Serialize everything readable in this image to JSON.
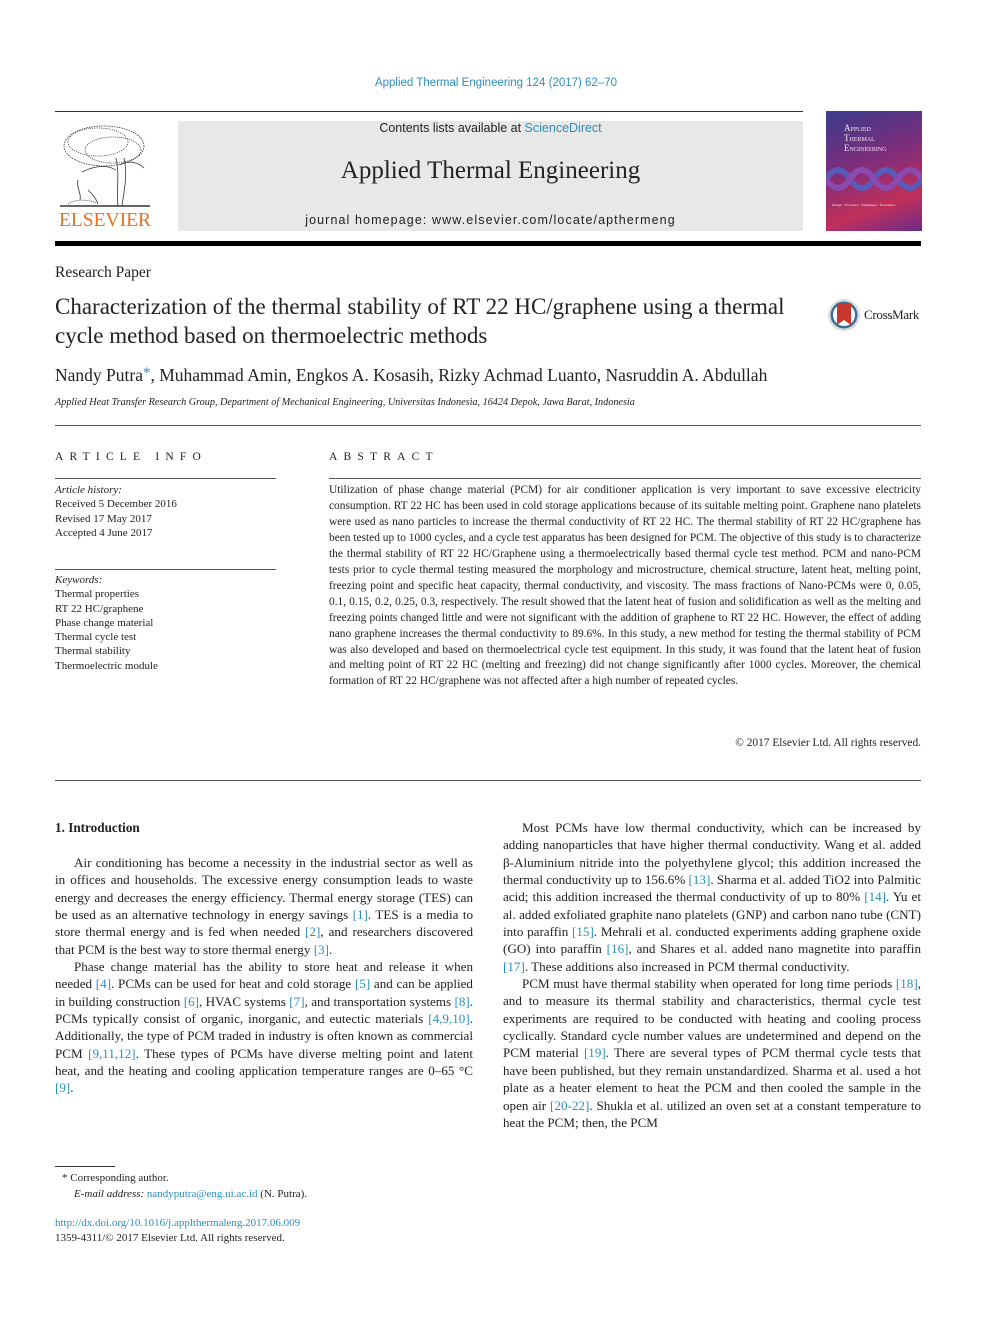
{
  "header": {
    "journal_ref": "Applied Thermal Engineering 124 (2017) 62–70",
    "contents_prefix": "Contents lists available at ",
    "contents_link": "ScienceDirect",
    "journal_title": "Applied Thermal Engineering",
    "homepage_prefix": "journal homepage: ",
    "homepage_url": "www.elsevier.com/locate/apthermeng",
    "publisher_logo": "ELSEVIER",
    "cover_title": [
      "Applied",
      "Thermal",
      "Engineering"
    ],
    "cover_subtitle": "Design · Processes · Equipment · Economics"
  },
  "article": {
    "type": "Research Paper",
    "title": "Characterization of the thermal stability of RT 22 HC/graphene using a thermal cycle method based on thermoelectric methods",
    "crossmark_label": "CrossMark",
    "authors": "Nandy Putra",
    "author_marker": "*",
    "authors_rest": ", Muhammad Amin, Engkos A. Kosasih, Rizky Achmad Luanto, Nasruddin A. Abdullah",
    "affiliation": "Applied Heat Transfer Research Group, Department of Mechanical Engineering, Universitas Indonesia, 16424 Depok, Jawa Barat, Indonesia"
  },
  "article_info": {
    "label": "ARTICLE INFO",
    "history_label": "Article history:",
    "history": [
      "Received 5 December 2016",
      "Revised 17 May 2017",
      "Accepted 4 June 2017"
    ],
    "keywords_label": "Keywords:",
    "keywords": [
      "Thermal properties",
      "RT 22 HC/graphene",
      "Phase change material",
      "Thermal cycle test",
      "Thermal stability",
      "Thermoelectric module"
    ]
  },
  "abstract": {
    "label": "ABSTRACT",
    "text": "Utilization of phase change material (PCM) for air conditioner application is very important to save excessive electricity consumption. RT 22 HC has been used in cold storage applications because of its suitable melting point. Graphene nano platelets were used as nano particles to increase the thermal conductivity of RT 22 HC. The thermal stability of RT 22 HC/graphene has been tested up to 1000 cycles, and a cycle test apparatus has been designed for PCM. The objective of this study is to characterize the thermal stability of RT 22 HC/Graphene using a thermoelectrically based thermal cycle test method. PCM and nano-PCM tests prior to cycle thermal testing measured the morphology and microstructure, chemical structure, latent heat, melting point, freezing point and specific heat capacity, thermal conductivity, and viscosity. The mass fractions of Nano-PCMs were 0, 0.05, 0.1, 0.15, 0.2, 0.25, 0.3, respectively. The result showed that the latent heat of fusion and solidification as well as the melting and freezing points changed little and were not significant with the addition of graphene to RT 22 HC. However, the effect of adding nano graphene increases the thermal conductivity to 89.6%. In this study, a new method for testing the thermal stability of PCM was also developed and based on thermoelectrical cycle test equipment. In this study, it was found that the latent heat of fusion and melting point of RT 22 HC (melting and freezing) did not change significantly after 1000 cycles. Moreover, the chemical formation of RT 22 HC/graphene was not affected after a high number of repeated cycles.",
    "copyright": "© 2017 Elsevier Ltd. All rights reserved."
  },
  "body": {
    "section_heading": "1. Introduction",
    "left_paragraphs": [
      [
        {
          "t": "Air conditioning has become a necessity in the industrial sector as well as in offices and households. The excessive energy consumption leads to waste energy and decreases the energy efficiency. Thermal energy storage (TES) can be used as an alternative technology in energy savings "
        },
        {
          "ref": "[1]"
        },
        {
          "t": ". TES is a media to store thermal energy and is fed when needed "
        },
        {
          "ref": "[2]"
        },
        {
          "t": ", and researchers discovered that PCM is the best way to store thermal energy "
        },
        {
          "ref": "[3]"
        },
        {
          "t": "."
        }
      ],
      [
        {
          "t": "Phase change material has the ability to store heat and release it when needed "
        },
        {
          "ref": "[4]"
        },
        {
          "t": ". PCMs can be used for heat and cold storage "
        },
        {
          "ref": "[5]"
        },
        {
          "t": " and can be applied in building construction "
        },
        {
          "ref": "[6]"
        },
        {
          "t": ", HVAC systems "
        },
        {
          "ref": "[7]"
        },
        {
          "t": ", and transportation systems "
        },
        {
          "ref": "[8]"
        },
        {
          "t": ". PCMs typically consist of organic, inorganic, and eutectic materials "
        },
        {
          "ref": "[4,9,10]"
        },
        {
          "t": ". Additionally, the type of PCM traded in industry is often known as commercial PCM "
        },
        {
          "ref": "[9,11,12]"
        },
        {
          "t": ". These types of PCMs have diverse melting point and latent heat, and the heating and cooling application temperature ranges are 0–65 °C "
        },
        {
          "ref": "[9]"
        },
        {
          "t": "."
        }
      ]
    ],
    "right_paragraphs": [
      [
        {
          "t": "Most PCMs have low thermal conductivity, which can be increased by adding nanoparticles that have higher thermal conductivity. Wang et al. added β-Aluminium nitride into the polyethylene glycol; this addition increased the thermal conductivity up to 156.6% "
        },
        {
          "ref": "[13]"
        },
        {
          "t": ". Sharma et al. added TiO2 into Palmitic acid; this addition increased the thermal conductivity of up to 80% "
        },
        {
          "ref": "[14]"
        },
        {
          "t": ". Yu et al. added exfoliated graphite nano platelets (GNP) and carbon nano tube (CNT) into paraffin "
        },
        {
          "ref": "[15]"
        },
        {
          "t": ". Mehrali et al. conducted experiments adding graphene oxide (GO) into paraffin "
        },
        {
          "ref": "[16]"
        },
        {
          "t": ", and Shares et al. added nano magnetite into paraffin "
        },
        {
          "ref": "[17]"
        },
        {
          "t": ". These additions also increased in PCM thermal conductivity."
        }
      ],
      [
        {
          "t": "PCM must have thermal stability when operated for long time periods "
        },
        {
          "ref": "[18]"
        },
        {
          "t": ", and to measure its thermal stability and characteristics, thermal cycle test experiments are required to be conducted with heating and cooling process cyclically. Standard cycle number values are undetermined and depend on the PCM material "
        },
        {
          "ref": "[19]"
        },
        {
          "t": ". There are several types of PCM thermal cycle tests that have been published, but they remain unstandardized. Sharma et al. used a hot plate as a heater element to heat the PCM and then cooled the sample in the open air "
        },
        {
          "ref": "[20-22]"
        },
        {
          "t": ". Shukla et al. utilized an oven set at a constant temperature to heat the PCM; then, the PCM"
        }
      ]
    ]
  },
  "footnotes": {
    "marker": "*",
    "corresponding": "Corresponding author.",
    "email_label": "E-mail address: ",
    "email": "nandyputra@eng.ui.ac.id",
    "email_suffix": " (N. Putra).",
    "doi": "http://dx.doi.org/10.1016/j.applthermaleng.2017.06.009",
    "issn_line": "1359-4311/© 2017 Elsevier Ltd. All rights reserved."
  },
  "colors": {
    "link": "#2a8fbd",
    "elsevier_orange": "#e9711c",
    "masthead_bg": "#e8e8e8",
    "crossmark_red": "#c8372d"
  }
}
